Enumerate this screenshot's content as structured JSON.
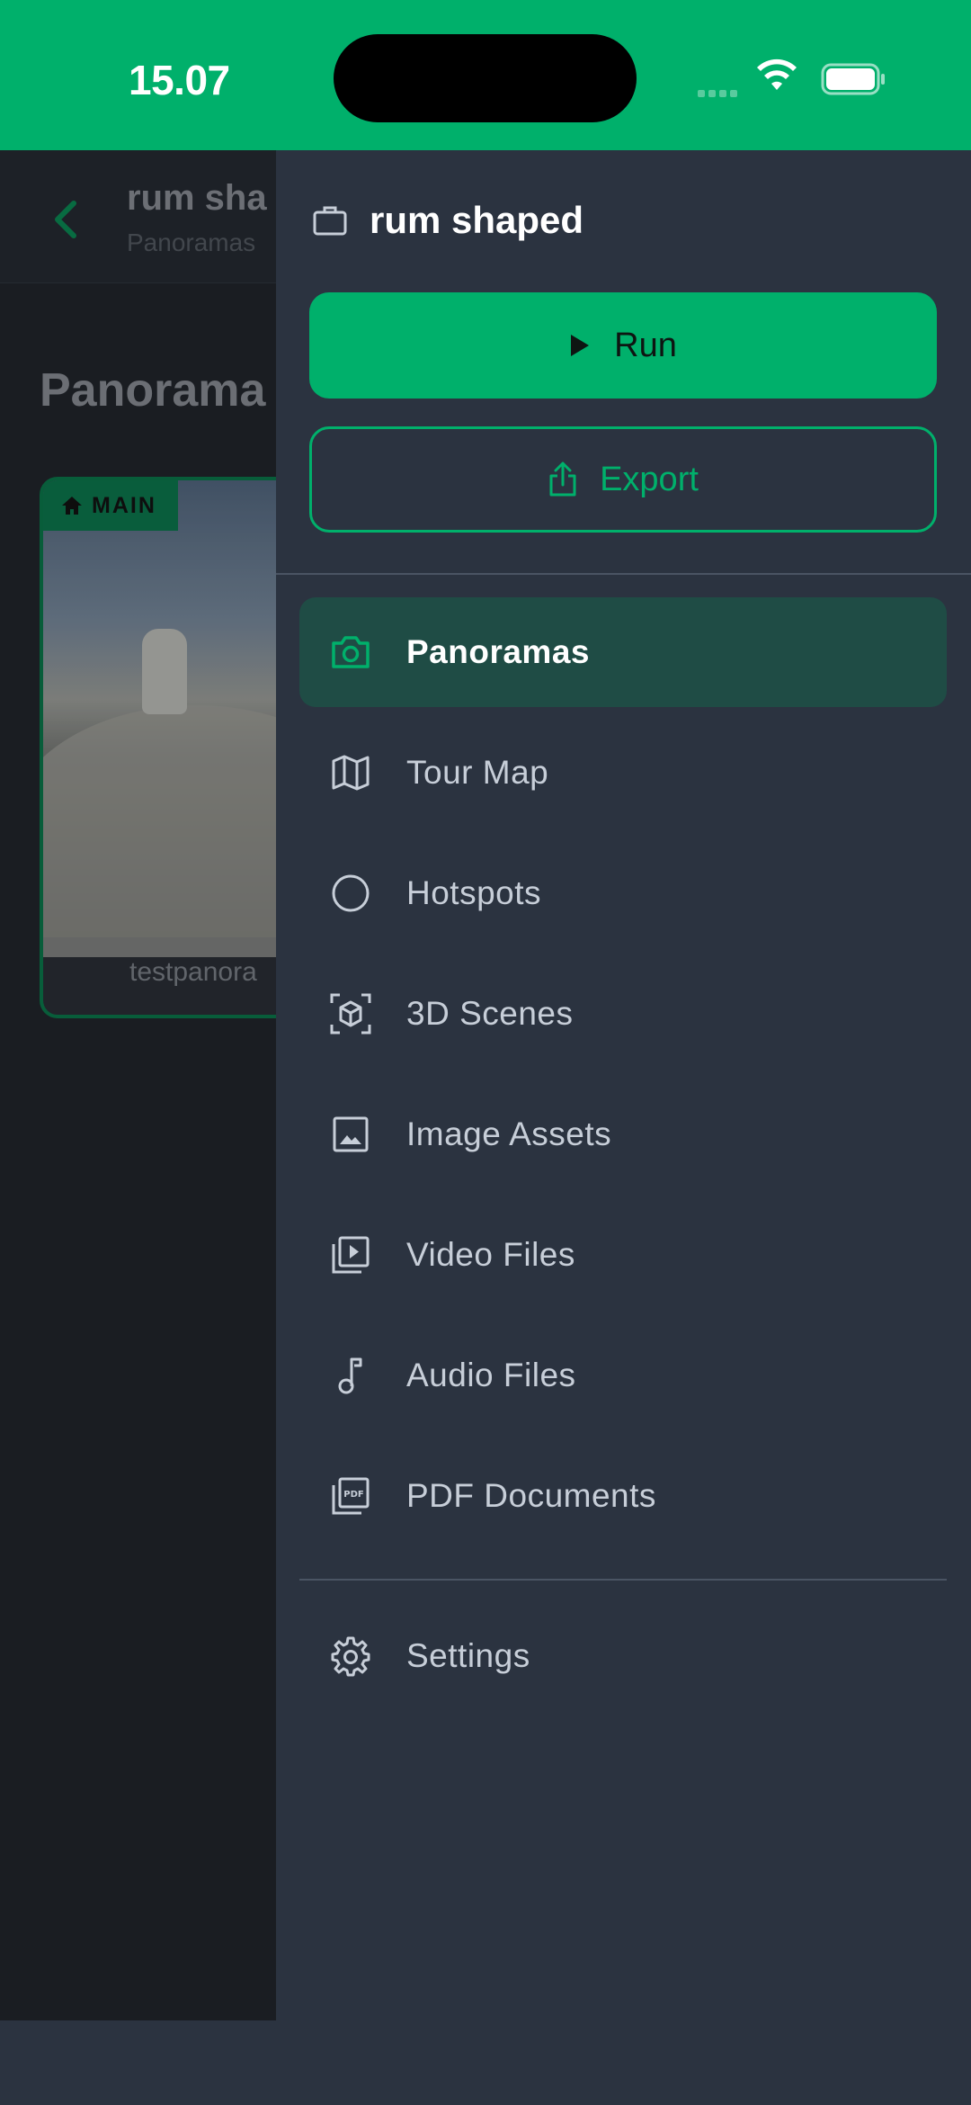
{
  "status_bar": {
    "time": "15.07"
  },
  "background": {
    "title": "rum sha",
    "subtitle": "Panoramas",
    "heading": "Panorama",
    "card": {
      "badge": "MAIN",
      "label": "testpanora"
    }
  },
  "drawer": {
    "project_name": "rum shaped",
    "run_label": "Run",
    "export_label": "Export",
    "nav": [
      {
        "label": "Panoramas",
        "icon": "camera-icon",
        "active": true
      },
      {
        "label": "Tour Map",
        "icon": "map-icon"
      },
      {
        "label": "Hotspots",
        "icon": "circle-icon"
      },
      {
        "label": "3D Scenes",
        "icon": "cube-icon"
      },
      {
        "label": "Image Assets",
        "icon": "image-icon"
      },
      {
        "label": "Video Files",
        "icon": "video-library-icon"
      },
      {
        "label": "Audio Files",
        "icon": "music-note-icon"
      },
      {
        "label": "PDF Documents",
        "icon": "pdf-icon"
      }
    ],
    "settings_label": "Settings"
  },
  "colors": {
    "accent": "#00b06b",
    "drawer_bg": "#2b3340",
    "active_bg": "#1f4c45"
  }
}
